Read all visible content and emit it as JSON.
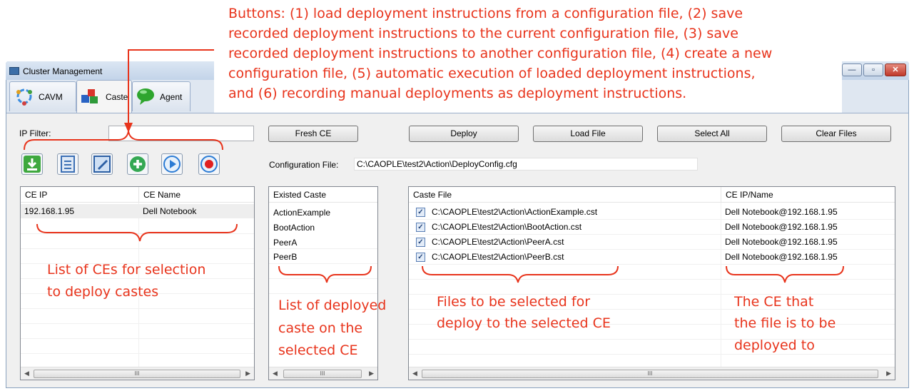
{
  "window": {
    "title": "Cluster Management",
    "controls": {
      "minimize": "—",
      "maximize": "▫",
      "close": "✕"
    }
  },
  "tabs": [
    {
      "label": "CAVM",
      "icon": "gear-cycle-icon"
    },
    {
      "label": "Caste",
      "icon": "blocks-icon"
    },
    {
      "label": "Agent",
      "icon": "speech-bubble-icon"
    }
  ],
  "toolbar": {
    "ip_filter_label": "IP Filter:",
    "ip_filter_value": "",
    "fresh_ce": "Fresh CE",
    "deploy": "Deploy",
    "load_file": "Load File",
    "select_all": "Select All",
    "clear_files": "Clear Files",
    "config_label": "Configuration File:",
    "config_path": "C:\\CAOPLE\\test2\\Action\\DeployConfig.cfg",
    "icons": [
      "load-config-icon",
      "save-config-icon",
      "save-as-config-icon",
      "new-config-icon",
      "play-icon",
      "record-icon"
    ]
  },
  "ce_table": {
    "columns": [
      "CE IP",
      "CE Name"
    ],
    "rows": [
      {
        "ip": "192.168.1.95",
        "name": "Dell Notebook"
      }
    ]
  },
  "caste_table": {
    "columns": [
      "Existed Caste"
    ],
    "rows": [
      "ActionExample",
      "BootAction",
      "PeerA",
      "PeerB"
    ]
  },
  "files_table": {
    "columns": [
      "Caste File",
      "CE IP/Name"
    ],
    "rows": [
      {
        "checked": true,
        "file": "C:\\CAOPLE\\test2\\Action\\ActionExample.cst",
        "ce": "Dell Notebook@192.168.1.95"
      },
      {
        "checked": true,
        "file": "C:\\CAOPLE\\test2\\Action\\BootAction.cst",
        "ce": "Dell Notebook@192.168.1.95"
      },
      {
        "checked": true,
        "file": "C:\\CAOPLE\\test2\\Action\\PeerA.cst",
        "ce": "Dell Notebook@192.168.1.95"
      },
      {
        "checked": true,
        "file": "C:\\CAOPLE\\test2\\Action\\PeerB.cst",
        "ce": "Dell Notebook@192.168.1.95"
      }
    ]
  },
  "scroll_arrows": {
    "left": "◀",
    "right": "▶",
    "grip": "III"
  },
  "annotations": {
    "top": [
      "Buttons: (1) load deployment instructions from a configuration file, (2) save",
      "recorded deployment instructions to the current configuration file, (3) save",
      "recorded deployment instructions to another configuration file, (4) create a new",
      "configuration file, (5) automatic execution of loaded deployment instructions,",
      "and (6) recording manual deployments as deployment instructions."
    ],
    "ce_list": [
      "List of CEs for selection",
      "to deploy castes"
    ],
    "caste_list": [
      "List of deployed",
      "caste on the",
      "selected CE"
    ],
    "files": [
      "Files to be selected for",
      "deploy to the selected CE"
    ],
    "ce_target": [
      "The CE that",
      "the file is to be",
      "deployed to"
    ]
  },
  "colors": {
    "annotation": "#e8341c",
    "window_frame": "#8aa2bf"
  }
}
